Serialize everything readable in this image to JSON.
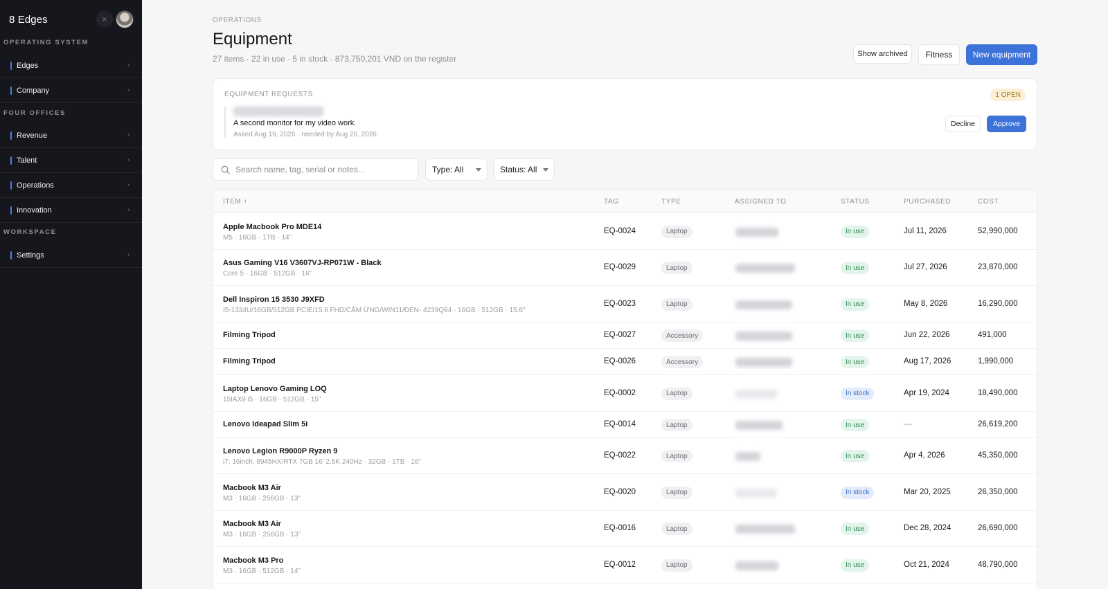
{
  "sidebar": {
    "brand": "8 Edges",
    "sections": [
      {
        "title": "OPERATING SYSTEM",
        "items": [
          {
            "label": "Edges"
          },
          {
            "label": "Company"
          }
        ]
      },
      {
        "title": "FOUR OFFICES",
        "items": [
          {
            "label": "Revenue"
          },
          {
            "label": "Talent"
          },
          {
            "label": "Operations"
          },
          {
            "label": "Innovation"
          }
        ]
      },
      {
        "title": "WORKSPACE",
        "items": [
          {
            "label": "Settings"
          }
        ]
      }
    ],
    "chevron_glyph": "›"
  },
  "header": {
    "breadcrumb": "OPERATIONS",
    "title": "Equipment",
    "subtitle": "27 items · 22 in use · 5 in stock · 873,750,201 VND on the register",
    "buttons": {
      "archived": "Show archived",
      "fitness": "Fitness",
      "new": "New equipment"
    }
  },
  "requests": {
    "title": "EQUIPMENT REQUESTS",
    "badge": "1 OPEN",
    "item": {
      "text": "A second monitor for my video work.",
      "meta": "Asked Aug 19, 2026 · needed by Aug 20, 2026"
    },
    "decline": "Decline",
    "approve": "Approve"
  },
  "filters": {
    "search_placeholder": "Search name, tag, serial or notes...",
    "type": "Type: All",
    "status": "Status: All"
  },
  "table": {
    "columns": [
      "ITEM ↑",
      "TAG",
      "TYPE",
      "ASSIGNED TO",
      "STATUS",
      "PURCHASED",
      "COST"
    ],
    "rows": [
      {
        "name": "Apple Macbook Pro MDE14",
        "specs": "M5 · 16GB · 1TB · 14\"",
        "tag": "EQ-0024",
        "type": "Laptop",
        "status": "In use",
        "purchased": "Jul 11, 2026",
        "cost": "52,990,000"
      },
      {
        "name": "Asus Gaming V16 V3607VJ-RP071W - Black",
        "specs": "Core 5 · 16GB · 512GB · 16\"",
        "tag": "EQ-0029",
        "type": "Laptop",
        "status": "In use",
        "purchased": "Jul 27, 2026",
        "cost": "23,870,000"
      },
      {
        "name": "Dell Inspiron 15 3530 J9XFD",
        "specs": "I5-1334U/16GB/512GB PCIE/15.6 FHD/CẢM ỨNG/WIN11/ĐEN- 4239Q94 · 16GB · 512GB · 15.6\"",
        "tag": "EQ-0023",
        "type": "Laptop",
        "status": "In use",
        "purchased": "May 8, 2026",
        "cost": "16,290,000"
      },
      {
        "name": "Filming Tripod",
        "specs": "",
        "tag": "EQ-0027",
        "type": "Accessory",
        "status": "In use",
        "purchased": "Jun 22, 2026",
        "cost": "491,000"
      },
      {
        "name": "Filming Tripod",
        "specs": "",
        "tag": "EQ-0026",
        "type": "Accessory",
        "status": "In use",
        "purchased": "Aug 17, 2026",
        "cost": "1,990,000"
      },
      {
        "name": "Laptop Lenovo Gaming LOQ",
        "specs": "15IAX9 i5 · 16GB · 512GB · 15\"",
        "tag": "EQ-0002",
        "type": "Laptop",
        "status": "In stock",
        "purchased": "Apr 19, 2024",
        "cost": "18,490,000"
      },
      {
        "name": "Lenovo Ideapad Slim 5i",
        "specs": "",
        "tag": "EQ-0014",
        "type": "Laptop",
        "status": "In use",
        "purchased": "—",
        "cost": "26,619,200"
      },
      {
        "name": "Lenovo Legion R9000P Ryzen 9",
        "specs": "i7, 16inch, 8945HX/RTX 7GB 16' 2.5K 240Hz · 32GB · 1TB · 16\"",
        "tag": "EQ-0022",
        "type": "Laptop",
        "status": "In use",
        "purchased": "Apr 4, 2026",
        "cost": "45,350,000"
      },
      {
        "name": "Macbook M3 Air",
        "specs": "M3 · 16GB · 256GB · 13\"",
        "tag": "EQ-0020",
        "type": "Laptop",
        "status": "In stock",
        "purchased": "Mar 20, 2025",
        "cost": "26,350,000"
      },
      {
        "name": "Macbook M3 Air",
        "specs": "M3 · 16GB · 256GB · 13\"",
        "tag": "EQ-0016",
        "type": "Laptop",
        "status": "In use",
        "purchased": "Dec 28, 2024",
        "cost": "26,690,000"
      },
      {
        "name": "Macbook M3 Pro",
        "specs": "M3 · 16GB · 512GB · 14\"",
        "tag": "EQ-0012",
        "type": "Laptop",
        "status": "In use",
        "purchased": "Oct 21, 2024",
        "cost": "48,790,000"
      }
    ]
  },
  "colors": {
    "accent": "#3d72d9",
    "sidebar_bg": "#16171c",
    "in_use": "#2f8e58",
    "in_stock": "#3a6bc8",
    "badge_open": "#a07a22"
  }
}
